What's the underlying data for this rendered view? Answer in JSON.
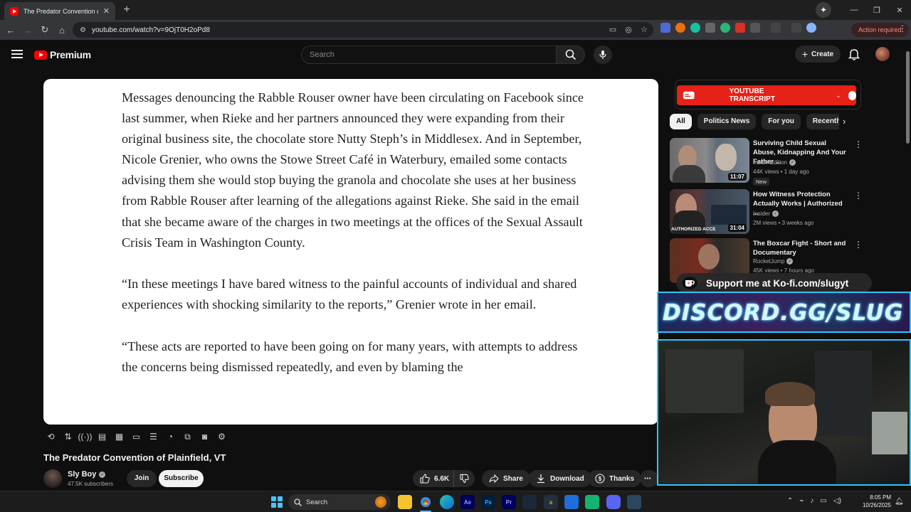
{
  "browser": {
    "tab_title": "The Predator Convention of Pla",
    "url": "youtube.com/watch?v=9OjT0H2oPd8",
    "action_required": "Action required"
  },
  "header": {
    "logo_text": "Premium",
    "search_placeholder": "Search",
    "create_label": "Create"
  },
  "article": {
    "paragraphs": [
      "Messages denouncing the Rabble Rouser owner have been circulating on Facebook since last summer, when Rieke and her partners announced they were expanding from their original business site, the chocolate store Nutty Steph’s in Middlesex. And in September, Nicole Grenier, who owns the Stowe Street Café in Waterbury, emailed some contacts advising them she would stop buying the granola and chocolate she uses at her business from Rabble Rouser after learning of the allegations against Rieke. She said in the email that she became aware of the charges in two meetings at the offices of the Sexual Assault Crisis Team in Washington County.",
      "“In these meetings I have bared witness to the painful accounts of individual and shared experiences with shocking similarity to the reports,” Grenier wrote in her email.",
      "“These acts are reported to have been going on for many years, with attempts to address the concerns being dismissed repeatedly, and even by blaming the"
    ]
  },
  "video": {
    "title": "The Predator Convention of Plainfield, VT",
    "channel": "Sly Boy",
    "subscribers": "47.5K subscribers",
    "join_label": "Join",
    "subscribe_label": "Subscribe",
    "likes": "6.6K",
    "share_label": "Share",
    "download_label": "Download",
    "thanks_label": "Thanks"
  },
  "sidebar": {
    "transcript_label": "YOUTUBE TRANSCRIPT",
    "chips": [
      "All",
      "Politics News",
      "For you",
      "Recently uploaded"
    ],
    "recommendations": [
      {
        "title": "Surviving Child Sexual Abuse, Kidnapping And Your Father ...",
        "channel": "Inside Edition",
        "meta": "44K views • 1 day ago",
        "badge": "New",
        "duration": "11:07"
      },
      {
        "title": "How Witness Protection Actually Works | Authorized ...",
        "channel": "Insider",
        "meta": "2M views • 3 weeks ago",
        "badge": "",
        "duration": "31:04",
        "thumb_caption": "AUTHORIZED ACCE"
      },
      {
        "title": "The Boxcar Fight - Short and Documentary",
        "channel": "RocketJump",
        "meta": "45K views • 7 hours ago",
        "badge": "",
        "duration": ""
      }
    ]
  },
  "overlays": {
    "kofi_text": "Support me at Ko-fi.com/slugyt",
    "discord_text": "DISCORD.GG/SLUG"
  },
  "taskbar": {
    "search_label": "Search",
    "time": "8:05 PM",
    "date": "10/26/2025"
  },
  "colors": {
    "youtube_red": "#ff0000",
    "transcript_red": "#e62117",
    "overlay_cyan": "#2dc6ff"
  }
}
